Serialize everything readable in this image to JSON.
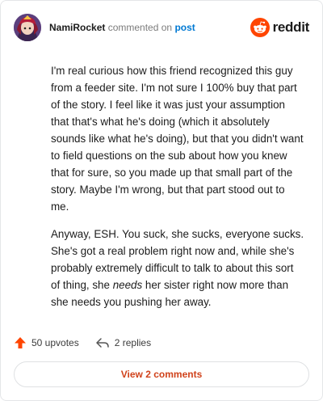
{
  "header": {
    "username": "NamiRocket",
    "action_text": "commented on",
    "post_link": "post",
    "brand": "reddit"
  },
  "comment": {
    "paragraph1": "I'm real curious how this friend recognized this guy from a feeder site. I'm not sure I 100% buy that part of the story. I feel like it was just your assumption that that's what he's doing (which it absolutely sounds like what he's doing), but that you didn't want to field questions on the sub about how you knew that for sure, so you made up that small part of the story. Maybe I'm wrong, but that part stood out to me.",
    "paragraph2_part1": "Anyway, ESH. You suck, she sucks, everyone sucks. She's got a real problem right now and, while she's probably extremely difficult to talk to about this sort of thing, she ",
    "paragraph2_emph": "needs",
    "paragraph2_part2": " her sister right now more than she needs you pushing her away."
  },
  "actions": {
    "upvotes": "50 upvotes",
    "replies": "2 replies"
  },
  "view_button": "View 2 comments",
  "colors": {
    "accent": "#ff4500",
    "link": "#0079d3",
    "button_text": "#d0421b"
  }
}
